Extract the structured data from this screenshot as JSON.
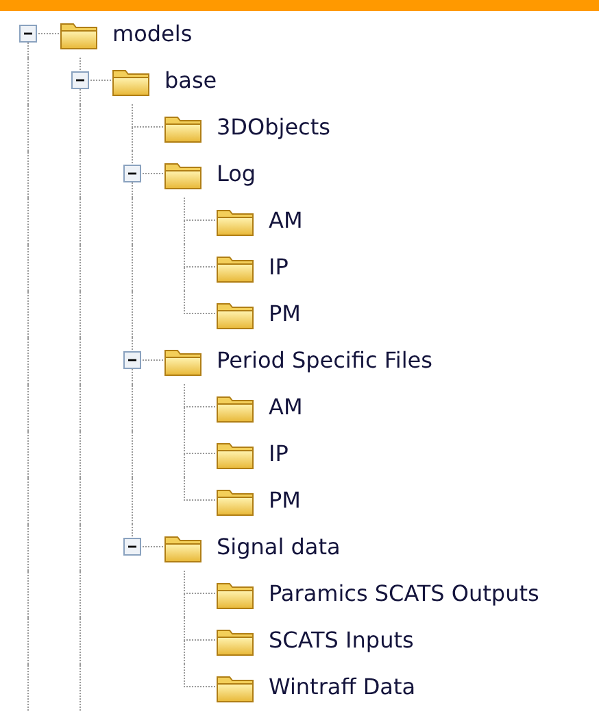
{
  "tree": [
    {
      "label": "models",
      "expanded": true,
      "children": [
        {
          "label": "base",
          "expanded": true,
          "children": [
            {
              "label": "3DObjects"
            },
            {
              "label": "Log",
              "expanded": true,
              "children": [
                {
                  "label": "AM"
                },
                {
                  "label": "IP"
                },
                {
                  "label": "PM"
                }
              ]
            },
            {
              "label": "Period Specific Files",
              "expanded": true,
              "children": [
                {
                  "label": "AM"
                },
                {
                  "label": "IP"
                },
                {
                  "label": "PM"
                }
              ]
            },
            {
              "label": "Signal data",
              "expanded": true,
              "children": [
                {
                  "label": "Paramics SCATS Outputs"
                },
                {
                  "label": "SCATS Inputs"
                },
                {
                  "label": "Wintraff Data"
                }
              ]
            }
          ]
        }
      ]
    }
  ]
}
